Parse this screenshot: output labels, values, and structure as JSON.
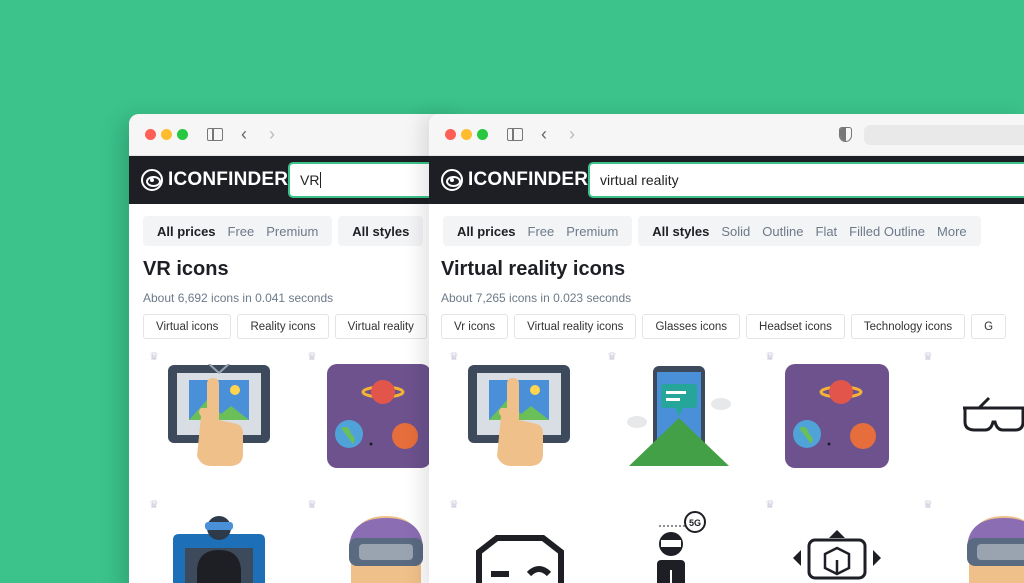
{
  "windows": [
    {
      "id": "win1",
      "logo": "ICONFINDER",
      "search_value": "VR",
      "filters": [
        {
          "items": [
            "All prices",
            "Free",
            "Premium"
          ]
        },
        {
          "items": [
            "All styles"
          ]
        }
      ],
      "title": "VR icons",
      "count": "About 6,692 icons in 0.041 seconds",
      "chips": [
        "Virtual icons",
        "Reality icons",
        "Virtual reality"
      ]
    },
    {
      "id": "win2",
      "logo": "ICONFINDER",
      "search_value": "virtual reality",
      "filters": [
        {
          "items": [
            "All prices",
            "Free",
            "Premium"
          ]
        },
        {
          "items": [
            "All styles",
            "Solid",
            "Outline",
            "Flat",
            "Filled Outline",
            "More"
          ]
        }
      ],
      "title": "Virtual reality icons",
      "count": "About 7,265 icons in 0.023 seconds",
      "chips": [
        "Vr icons",
        "Virtual reality icons",
        "Glasses icons",
        "Headset icons",
        "Technology icons",
        "G"
      ]
    }
  ],
  "icons": {
    "tablet_touch": "tablet-touch-icon",
    "space_planets": "space-planets-icon",
    "phone_chat": "phone-chat-icon",
    "vr_glasses": "vr-glasses-outline-icon",
    "vr_person": "vr-person-icon",
    "vr_headset_user": "vr-headset-user-icon",
    "vr_headset_outline": "vr-headset-outline-icon",
    "vr_5g_person": "vr-5g-person-icon",
    "vr_cube": "vr-cube-icon",
    "badge_5g": "5G"
  },
  "colors": {
    "background": "#3bc38b",
    "header": "#1d1f24",
    "accent": "#3bc38b"
  }
}
